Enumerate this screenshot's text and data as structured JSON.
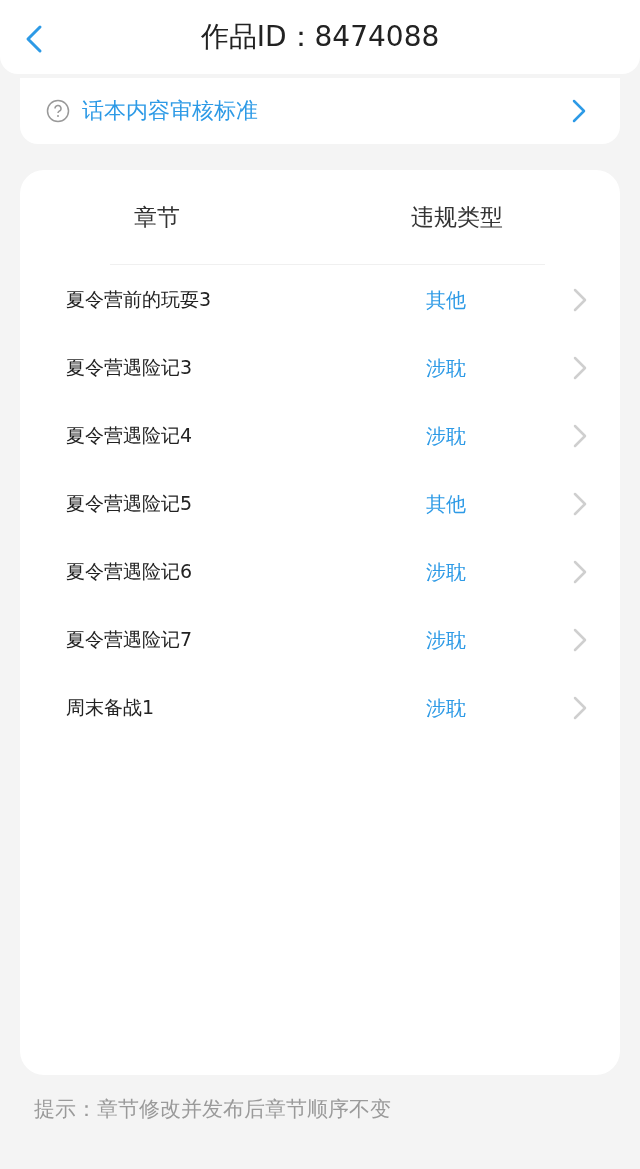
{
  "header": {
    "title": "作品ID：8474088"
  },
  "standard_link": {
    "label": "话本内容审核标准"
  },
  "table": {
    "columns": [
      "章节",
      "违规类型"
    ],
    "rows": [
      {
        "chapter": "夏令营前的玩耍3",
        "violation": "其他"
      },
      {
        "chapter": "夏令营遇险记3",
        "violation": "涉耽"
      },
      {
        "chapter": "夏令营遇险记4",
        "violation": "涉耽"
      },
      {
        "chapter": "夏令营遇险记5",
        "violation": "其他"
      },
      {
        "chapter": "夏令营遇险记6",
        "violation": "涉耽"
      },
      {
        "chapter": "夏令营遇险记7",
        "violation": "涉耽"
      },
      {
        "chapter": "周末备战1",
        "violation": "涉耽"
      }
    ]
  },
  "hint": "提示：章节修改并发布后章节顺序不变"
}
